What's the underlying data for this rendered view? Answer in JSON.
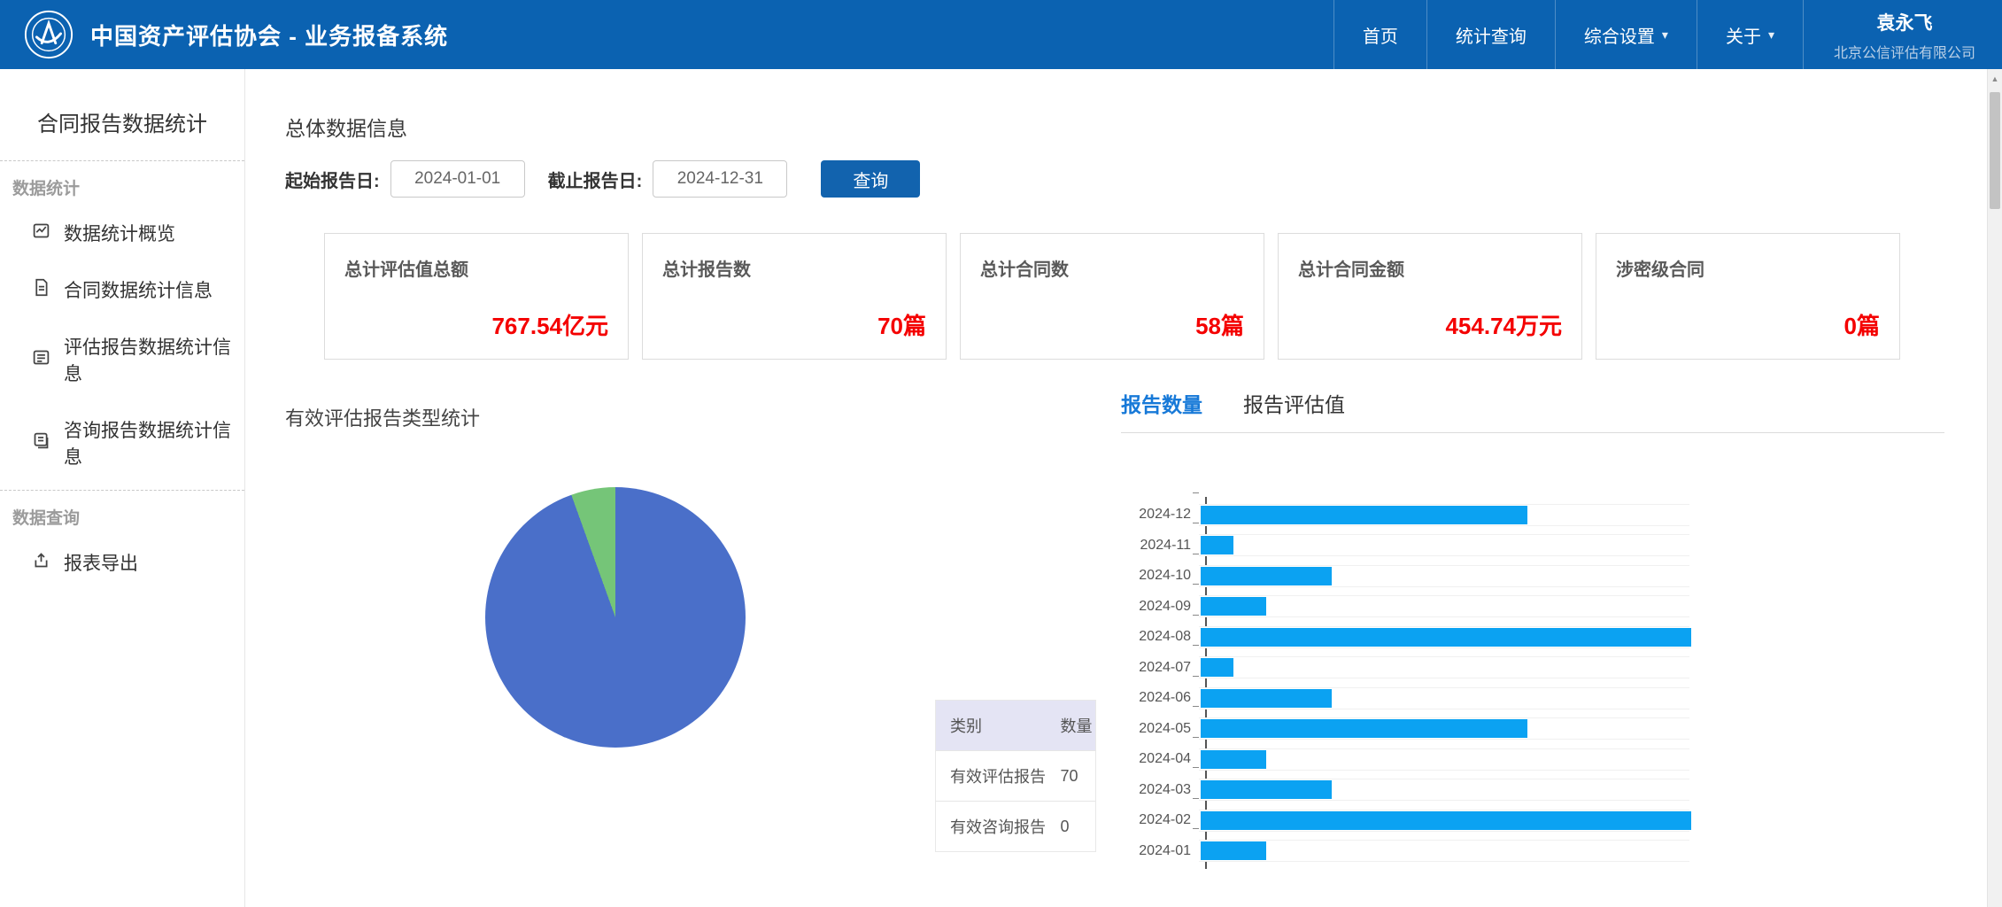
{
  "header": {
    "title": "中国资产评估协会 - 业务报备系统",
    "nav": [
      {
        "label": "首页",
        "has_dropdown": false
      },
      {
        "label": "统计查询",
        "has_dropdown": false
      },
      {
        "label": "综合设置",
        "has_dropdown": true
      },
      {
        "label": "关于",
        "has_dropdown": true
      }
    ],
    "user": {
      "name": "袁永飞",
      "company": "北京公信评估有限公司"
    }
  },
  "sidebar": {
    "title": "合同报告数据统计",
    "sections": [
      {
        "title": "数据统计",
        "items": [
          {
            "label": "数据统计概览",
            "icon": "line-chart-icon"
          },
          {
            "label": "合同数据统计信息",
            "icon": "file-text-icon"
          },
          {
            "label": "评估报告数据统计信息",
            "icon": "list-icon"
          },
          {
            "label": "咨询报告数据统计信息",
            "icon": "file-copy-icon"
          }
        ]
      },
      {
        "title": "数据查询",
        "items": [
          {
            "label": "报表导出",
            "icon": "export-icon"
          }
        ]
      }
    ]
  },
  "main": {
    "section_title": "总体数据信息",
    "filter": {
      "start_label": "起始报告日:",
      "start_value": "2024-01-01",
      "end_label": "截止报告日:",
      "end_value": "2024-12-31",
      "query_button": "查询"
    },
    "stat_cards": [
      {
        "label": "总计评估值总额",
        "value": "767.54亿元"
      },
      {
        "label": "总计报告数",
        "value": "70篇"
      },
      {
        "label": "总计合同数",
        "value": "58篇"
      },
      {
        "label": "总计合同金额",
        "value": "454.74万元"
      },
      {
        "label": "涉密级合同",
        "value": "0篇"
      }
    ],
    "pie_section": {
      "title": "有效评估报告类型统计"
    },
    "type_table": {
      "headers": [
        "类别",
        "数量"
      ],
      "rows": [
        [
          "有效评估报告",
          "70"
        ],
        [
          "有效咨询报告",
          "0"
        ]
      ]
    },
    "tabs": [
      {
        "label": "报告数量",
        "active": true
      },
      {
        "label": "报告评估值",
        "active": false
      }
    ]
  },
  "chart_data": [
    {
      "type": "pie",
      "title": "有效评估报告类型统计",
      "slices": [
        {
          "name": "blue-slice",
          "value": 94.5,
          "color": "#4a6fc9"
        },
        {
          "name": "green-slice",
          "value": 5.5,
          "color": "#75c578"
        }
      ],
      "legend_position": "none"
    },
    {
      "type": "bar",
      "orientation": "horizontal",
      "title": "报告数量",
      "categories": [
        "2024-12",
        "2024-11",
        "2024-10",
        "2024-09",
        "2024-08",
        "2024-07",
        "2024-06",
        "2024-05",
        "2024-04",
        "2024-03",
        "2024-02",
        "2024-01"
      ],
      "values": [
        10,
        1,
        4,
        2,
        15,
        1,
        4,
        10,
        2,
        4,
        15,
        2
      ],
      "xlabel": "",
      "ylabel": "",
      "xlim": [
        0,
        15
      ],
      "grid": false,
      "bar_color": "#0ba2f2"
    }
  ],
  "colors": {
    "header_bg": "#0b62b1",
    "accent": "#1263ae",
    "tab_active": "#1779d8",
    "value_red": "#f40000",
    "bar_blue": "#0ba2f2",
    "table_head_bg": "#e4e4f4"
  }
}
